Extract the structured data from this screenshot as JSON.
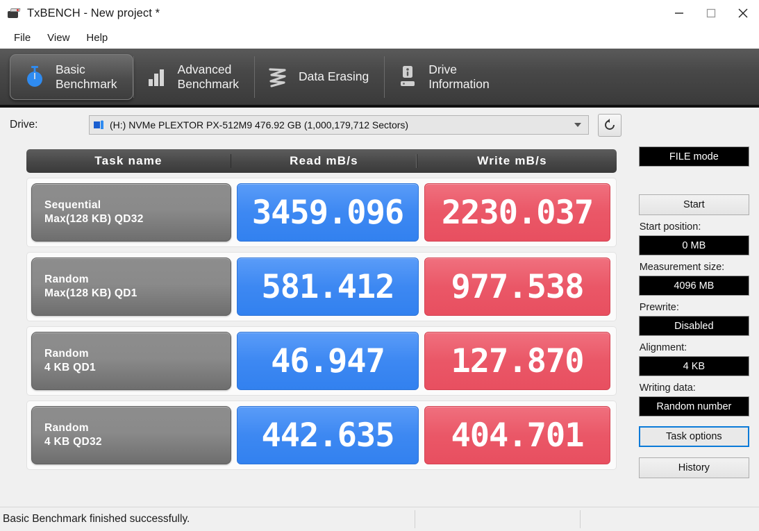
{
  "window": {
    "title": "TxBENCH - New project *",
    "icon": "txbench-app-icon",
    "controls": {
      "minimize": "minimize-icon",
      "maximize": "maximize-icon",
      "close": "close-icon"
    }
  },
  "menu": {
    "items": [
      "File",
      "View",
      "Help"
    ]
  },
  "tabs": [
    {
      "label": "Basic\nBenchmark",
      "icon": "stopwatch-icon",
      "active": true
    },
    {
      "label": "Advanced\nBenchmark",
      "icon": "bar-chart-icon",
      "active": false
    },
    {
      "label": "Data Erasing",
      "icon": "scribble-erase-icon",
      "active": false
    },
    {
      "label": "Drive\nInformation",
      "icon": "drive-info-icon",
      "active": false
    }
  ],
  "drive": {
    "label": "Drive:",
    "selected": "(H:) NVMe PLEXTOR PX-512M9  476.92 GB (1,000,179,712 Sectors)",
    "glyph": "hard-drive-icon",
    "refresh_icon": "refresh-icon"
  },
  "table": {
    "headers": [
      "Task name",
      "Read mB/s",
      "Write mB/s"
    ],
    "rows": [
      {
        "line1": "Sequential",
        "line2": "Max(128 KB) QD32",
        "read": "3459.096",
        "write": "2230.037"
      },
      {
        "line1": "Random",
        "line2": "Max(128 KB) QD1",
        "read": "581.412",
        "write": "977.538"
      },
      {
        "line1": "Random",
        "line2": "4 KB QD1",
        "read": "46.947",
        "write": "127.870"
      },
      {
        "line1": "Random",
        "line2": "4 KB QD32",
        "read": "442.635",
        "write": "404.701"
      }
    ]
  },
  "sidebar": {
    "mode": "FILE mode",
    "start_button": "Start",
    "fields": [
      {
        "label": "Start position:",
        "value": "0 MB"
      },
      {
        "label": "Measurement size:",
        "value": "4096 MB"
      },
      {
        "label": "Prewrite:",
        "value": "Disabled"
      },
      {
        "label": "Alignment:",
        "value": "4 KB"
      },
      {
        "label": "Writing data:",
        "value": "Random number"
      }
    ],
    "task_options_button": "Task options",
    "history_button": "History"
  },
  "statusbar": {
    "message": "Basic Benchmark finished successfully."
  },
  "colors": {
    "read_accent": "#3d88f2",
    "write_accent": "#ea5767",
    "task_cell": "#8a8a8a",
    "tab_strip": "#484848",
    "focus_border": "#0a7ad8"
  }
}
